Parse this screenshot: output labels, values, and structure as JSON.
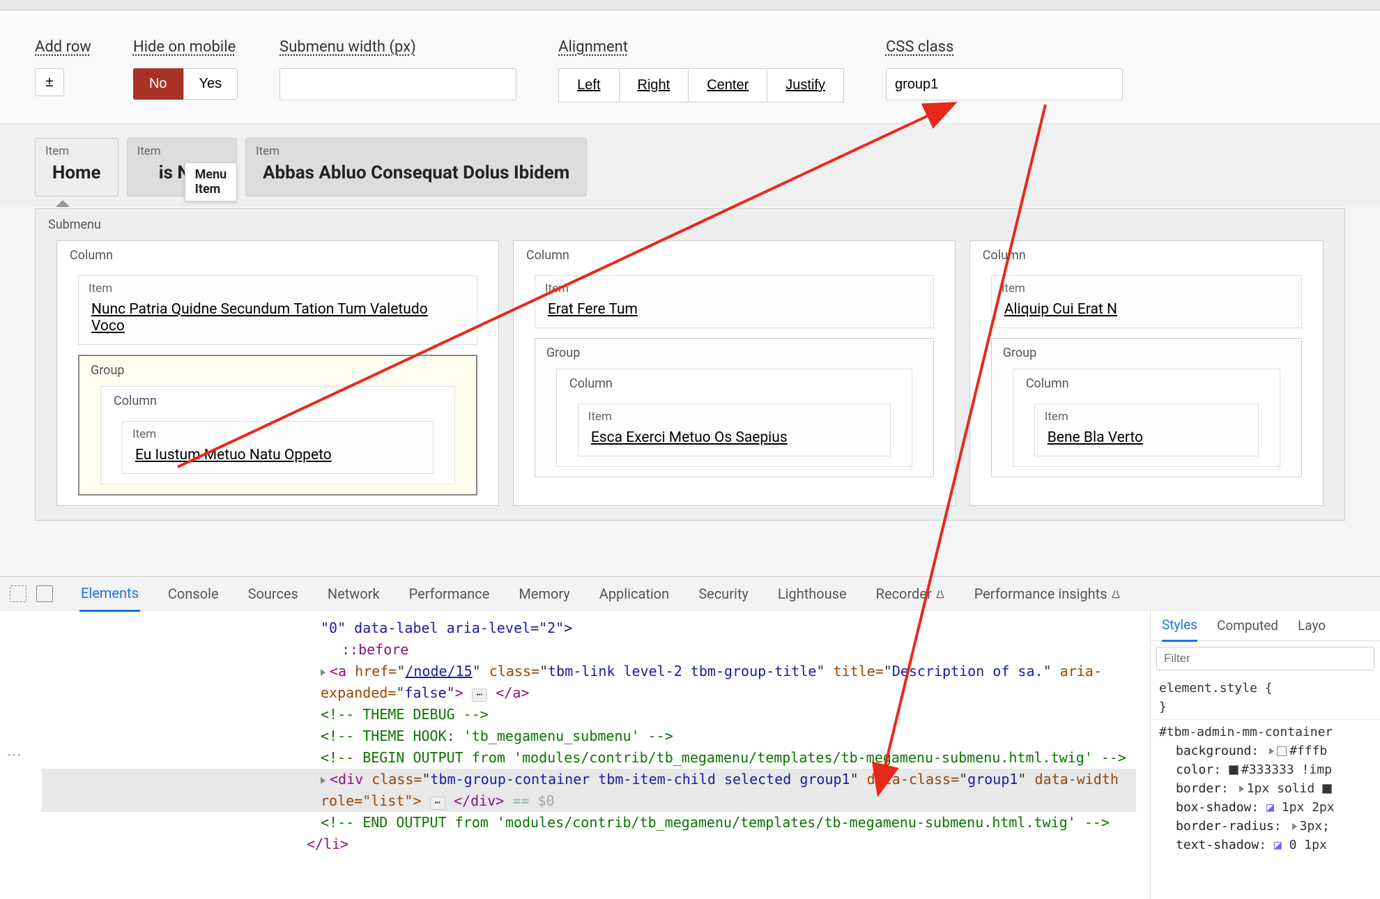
{
  "toolbar": {
    "add_row_label": "Add row",
    "add_row_btn": "±",
    "hide_mobile_label": "Hide on mobile",
    "hide_mobile_no": "No",
    "hide_mobile_yes": "Yes",
    "submenu_width_label": "Submenu width (px)",
    "submenu_width_value": "",
    "alignment_label": "Alignment",
    "align_left": "Left",
    "align_right": "Right",
    "align_center": "Center",
    "align_justify": "Justify",
    "css_class_label": "CSS class",
    "css_class_value": "group1"
  },
  "menu_items": [
    {
      "label": "Item",
      "title": "Home"
    },
    {
      "label": "Item",
      "title": "is Nulla",
      "tooltip": "Menu Item"
    },
    {
      "label": "Item",
      "title": "Abbas Abluo Consequat Dolus Ibidem"
    }
  ],
  "submenu": {
    "label": "Submenu",
    "columns": [
      {
        "label": "Column",
        "item": {
          "label": "Item",
          "title": "Nunc Patria Quidne Secundum Tation Tum Valetudo Voco"
        },
        "group": {
          "label": "Group",
          "highlighted": true,
          "column": {
            "label": "Column",
            "item": {
              "label": "Item",
              "title": "Eu Iustum Metuo Natu Oppeto"
            }
          }
        }
      },
      {
        "label": "Column",
        "item": {
          "label": "Item",
          "title": "Erat Fere Tum"
        },
        "group": {
          "label": "Group",
          "highlighted": false,
          "column": {
            "label": "Column",
            "item": {
              "label": "Item",
              "title": "Esca Exerci Metuo Os Saepius"
            }
          }
        }
      },
      {
        "label": "Column",
        "item": {
          "label": "Item",
          "title": "Aliquip Cui Erat N"
        },
        "group": {
          "label": "Group",
          "highlighted": false,
          "column": {
            "label": "Column",
            "item": {
              "label": "Item",
              "title": "Bene Bla Verto"
            }
          }
        }
      }
    ]
  },
  "devtools": {
    "tabs": [
      "Elements",
      "Console",
      "Sources",
      "Network",
      "Performance",
      "Memory",
      "Application",
      "Security",
      "Lighthouse",
      "Recorder",
      "Performance insights"
    ],
    "active_tab": "Elements",
    "dom": {
      "line1_attrs": "\"0\" data-label aria-level=\"2\">",
      "line2": "::before",
      "line3_href": "/node/15",
      "line3_class": "tbm-link level-2 tbm-group-title",
      "line3_title": "Description of sa.",
      "line3_aria": "false",
      "comment1": "THEME DEBUG",
      "comment2": "THEME HOOK: 'tb_megamenu_submenu'",
      "comment3": "BEGIN OUTPUT from 'modules/contrib/tb_megamenu/templates/tb-megamenu-submenu.html.twig'",
      "div_class": "tbm-group-container tbm-item-child selected group1",
      "div_data_class": "group1",
      "div_trailing": "data-width role=\"list\">",
      "div_var": "== $0",
      "comment4": "END OUTPUT from 'modules/contrib/tb_megamenu/templates/tb-megamenu-submenu.html.twig'",
      "close_li": "</li>"
    },
    "styles": {
      "tabs": [
        "Styles",
        "Computed",
        "Layo"
      ],
      "active": "Styles",
      "filter_placeholder": "Filter",
      "element_style": "element.style {",
      "selector": "#tbm-admin-mm-container",
      "props": [
        {
          "name": "background",
          "value": "#fffb",
          "swatch": "#ffffff"
        },
        {
          "name": "color",
          "value": "#333333 !imp",
          "swatch": "#333333"
        },
        {
          "name": "border",
          "value": "1px solid",
          "swatch": "#333333"
        },
        {
          "name": "box-shadow",
          "value": "1px 2px"
        },
        {
          "name": "border-radius",
          "value": "3px;"
        },
        {
          "name": "text-shadow",
          "value": "0 1px"
        }
      ]
    }
  }
}
